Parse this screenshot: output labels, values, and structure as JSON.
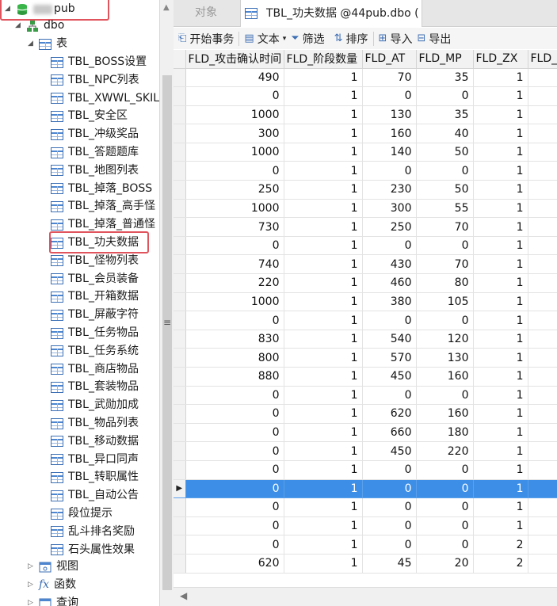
{
  "tree": {
    "connection_label": "pub",
    "schema_label": "dbo",
    "tables_group_label": "表",
    "tables": [
      "TBL_BOSS设置",
      "TBL_NPC列表",
      "TBL_XWWL_SKILL",
      "TBL_安全区",
      "TBL_冲级奖品",
      "TBL_答题题库",
      "TBL_地图列表",
      "TBL_掉落_BOSS",
      "TBL_掉落_高手怪",
      "TBL_掉落_普通怪",
      "TBL_功夫数据",
      "TBL_怪物列表",
      "TBL_会员装备",
      "TBL_开箱数据",
      "TBL_屏蔽字符",
      "TBL_任务物品",
      "TBL_任务系统",
      "TBL_商店物品",
      "TBL_套装物品",
      "TBL_武勋加成",
      "TBL_物品列表",
      "TBL_移动数据",
      "TBL_异口同声",
      "TBL_转职属性",
      "TBL_自动公告",
      "段位提示",
      "乱斗排名奖励",
      "石头属性效果"
    ],
    "views_label": "视图",
    "functions_label": "函数",
    "queries_label": "查询"
  },
  "tabs": {
    "objects_label": "对象",
    "data_tab_label": "TBL_功夫数据 @44pub.dbo ("
  },
  "toolbar": {
    "begin_transaction": "开始事务",
    "text": "文本",
    "filter": "筛选",
    "sort": "排序",
    "import": "导入",
    "export": "导出"
  },
  "grid": {
    "columns": [
      "FLD_攻击确认时间",
      "FLD_阶段数量",
      "FLD_AT",
      "FLD_MP",
      "FLD_ZX",
      "FLD_"
    ],
    "rows": [
      [
        "490",
        "1",
        "70",
        "35",
        "1"
      ],
      [
        "0",
        "1",
        "0",
        "0",
        "1"
      ],
      [
        "1000",
        "1",
        "130",
        "35",
        "1"
      ],
      [
        "300",
        "1",
        "160",
        "40",
        "1"
      ],
      [
        "1000",
        "1",
        "140",
        "50",
        "1"
      ],
      [
        "0",
        "1",
        "0",
        "0",
        "1"
      ],
      [
        "250",
        "1",
        "230",
        "50",
        "1"
      ],
      [
        "1000",
        "1",
        "300",
        "55",
        "1"
      ],
      [
        "730",
        "1",
        "250",
        "70",
        "1"
      ],
      [
        "0",
        "1",
        "0",
        "0",
        "1"
      ],
      [
        "740",
        "1",
        "430",
        "70",
        "1"
      ],
      [
        "220",
        "1",
        "460",
        "80",
        "1"
      ],
      [
        "1000",
        "1",
        "380",
        "105",
        "1"
      ],
      [
        "0",
        "1",
        "0",
        "0",
        "1"
      ],
      [
        "830",
        "1",
        "540",
        "120",
        "1"
      ],
      [
        "800",
        "1",
        "570",
        "130",
        "1"
      ],
      [
        "880",
        "1",
        "450",
        "160",
        "1"
      ],
      [
        "0",
        "1",
        "0",
        "0",
        "1"
      ],
      [
        "0",
        "1",
        "620",
        "160",
        "1"
      ],
      [
        "0",
        "1",
        "660",
        "180",
        "1"
      ],
      [
        "0",
        "1",
        "450",
        "220",
        "1"
      ],
      [
        "0",
        "1",
        "0",
        "0",
        "1"
      ],
      [
        "0",
        "1",
        "0",
        "0",
        "1"
      ],
      [
        "0",
        "1",
        "0",
        "0",
        "1"
      ],
      [
        "0",
        "1",
        "0",
        "0",
        "1"
      ],
      [
        "0",
        "1",
        "0",
        "0",
        "2"
      ],
      [
        "620",
        "1",
        "45",
        "20",
        "2"
      ]
    ],
    "selected_row_index": 22
  },
  "colors": {
    "selection": "#3d8ee6",
    "highlight_box": "#e0545d",
    "table_icon": "#3b6fb5"
  }
}
